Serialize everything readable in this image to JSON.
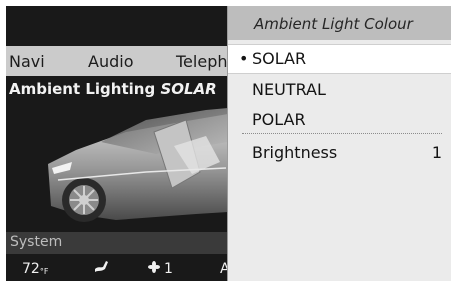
{
  "tabs": [
    "Navi",
    "Audio",
    "Teleph"
  ],
  "ambient": {
    "label": "Ambient Lighting",
    "value": "SOLAR"
  },
  "system_label": "System",
  "climate": {
    "temperature": "72",
    "temp_unit": "°F",
    "fan_level": "1",
    "more": "A"
  },
  "menu": {
    "title": "Ambient Light Colour",
    "selected_bullet": "•",
    "options": [
      "SOLAR",
      "NEUTRAL",
      "POLAR"
    ],
    "brightness_label": "Brightness",
    "brightness_value": "1"
  },
  "icons": {
    "seat": "seat-heating-icon",
    "fan": "fan-icon"
  }
}
